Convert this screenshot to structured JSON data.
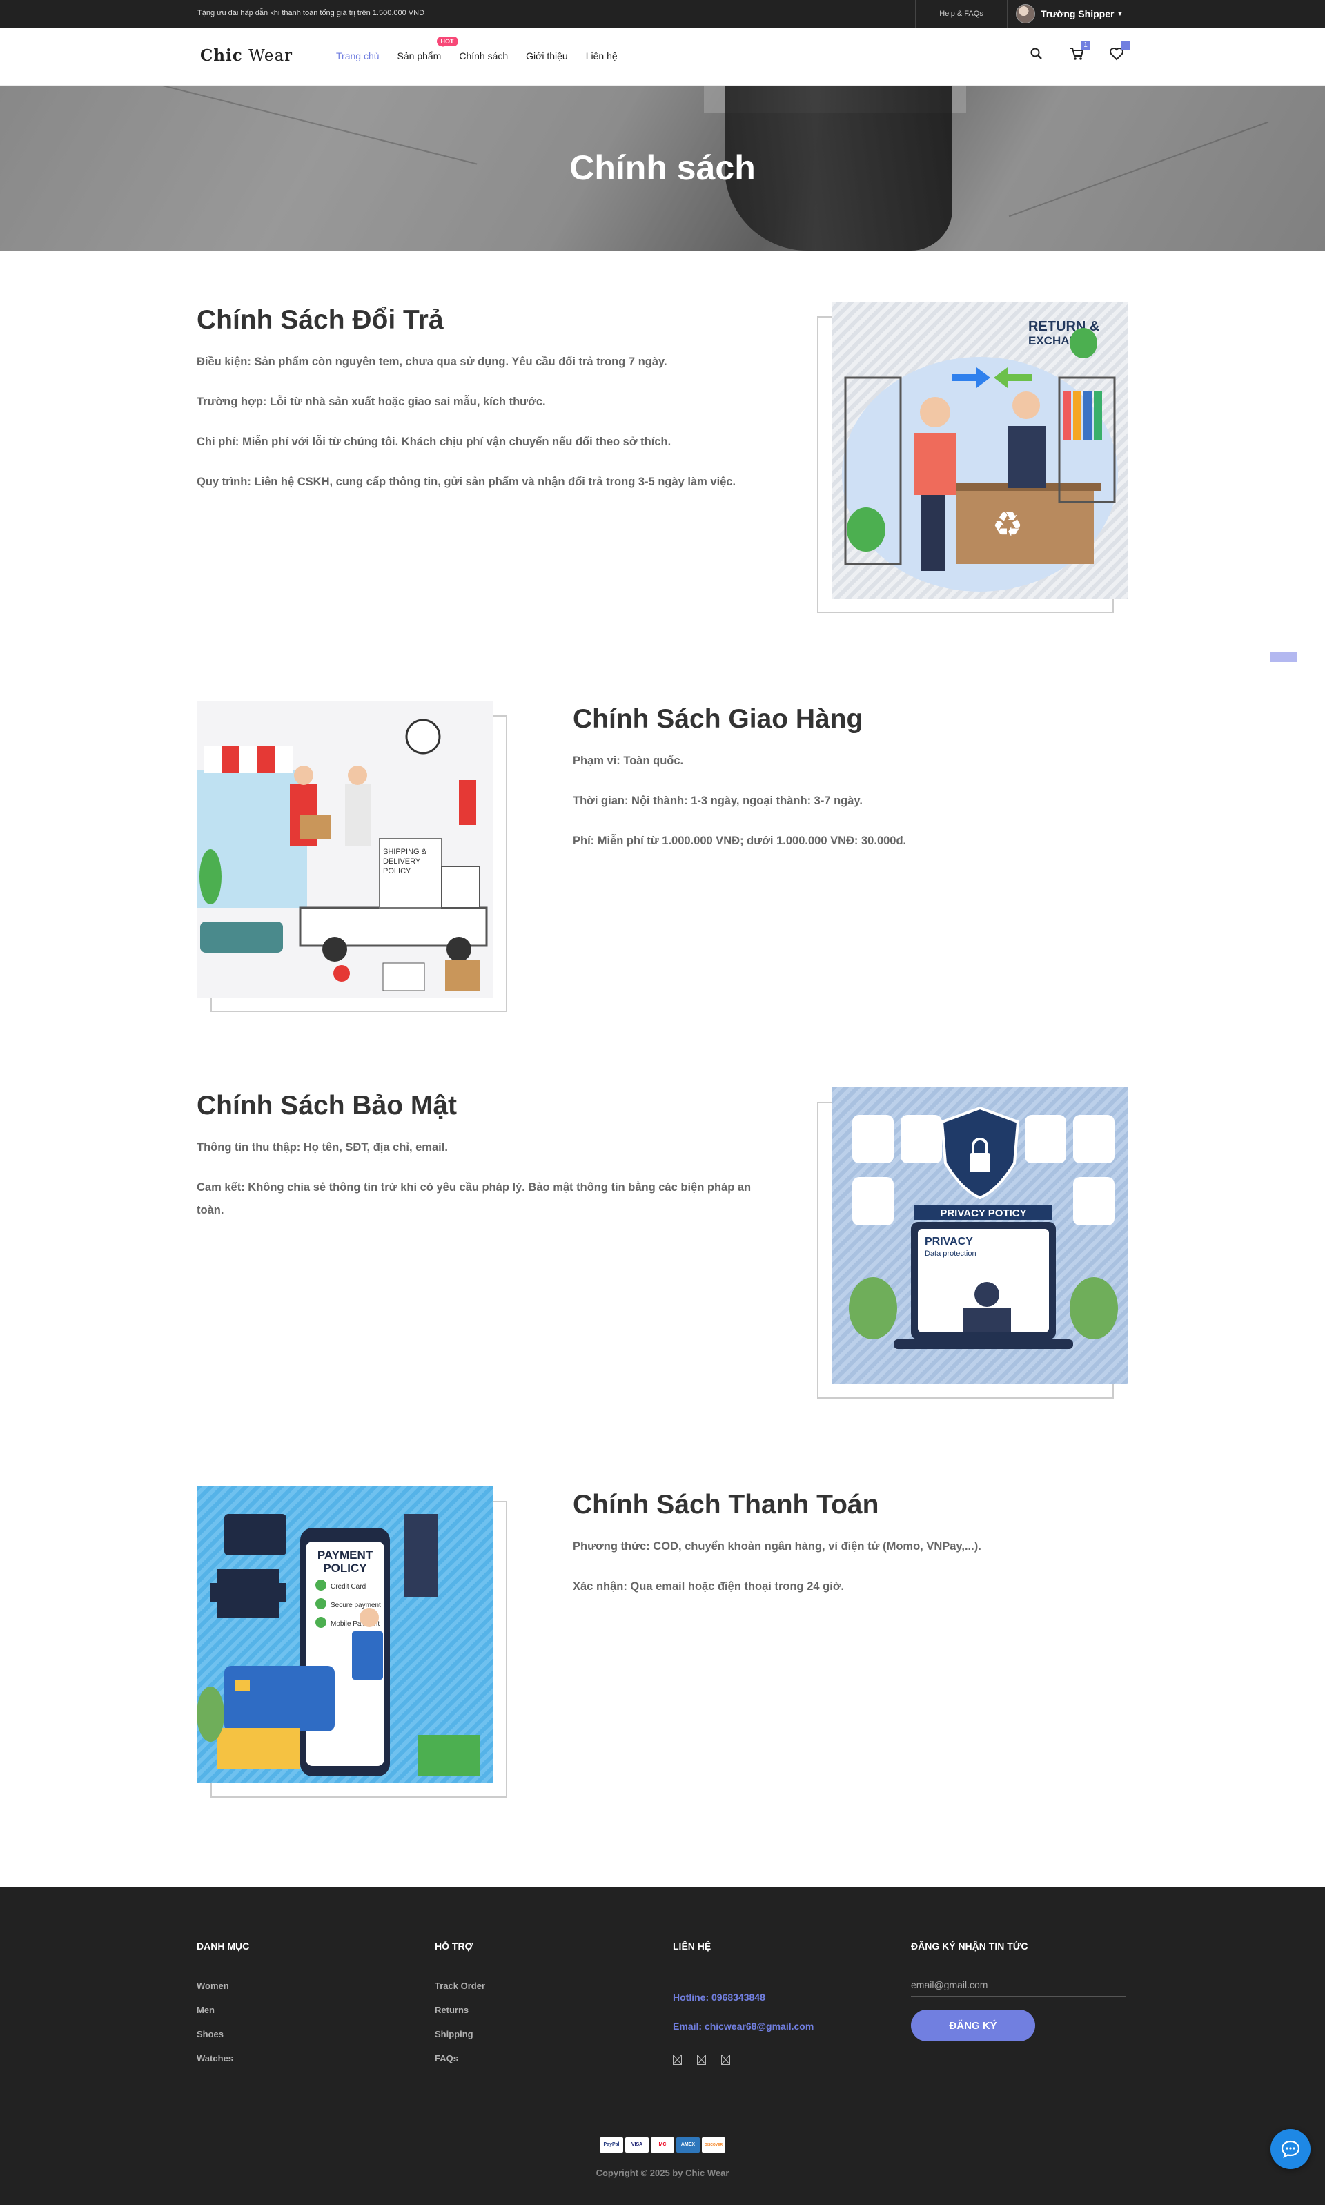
{
  "topbar": {
    "promo": "Tặng ưu đãi hấp dẫn khi thanh toán tổng giá trị trên 1.500.000 VND",
    "help": "Help & FAQs",
    "user_name": "Trường Shipper"
  },
  "header": {
    "logo_bold": "Chic",
    "logo_rest": "Wear",
    "nav": [
      {
        "label": "Trang chủ",
        "active": true
      },
      {
        "label": "Sản phẩm",
        "badge": "HOT"
      },
      {
        "label": "Chính sách"
      },
      {
        "label": "Giới thiệu"
      },
      {
        "label": "Liên hệ"
      }
    ],
    "cart_count": "1",
    "wishlist_count": ""
  },
  "banner": {
    "title": "Chính sách"
  },
  "policies": [
    {
      "title": "Chính Sách Đổi Trả",
      "paragraphs": [
        "Điều kiện: Sản phẩm còn nguyên tem, chưa qua sử dụng. Yêu cầu đổi trả trong 7 ngày.",
        "Trường hợp: Lỗi từ nhà sản xuất hoặc giao sai mẫu, kích thước.",
        "Chi phí: Miễn phí với lỗi từ chúng tôi. Khách chịu phí vận chuyển nếu đổi theo sở thích.",
        "Quy trình: Liên hệ CSKH, cung cấp thông tin, gửi sản phẩm và nhận đổi trả trong 3-5 ngày làm việc."
      ],
      "image_text": [
        "RETURN &",
        "EXCHANGE"
      ]
    },
    {
      "title": "Chính Sách Giao Hàng",
      "paragraphs": [
        "Phạm vi: Toàn quốc.",
        "Thời gian: Nội thành: 1-3 ngày, ngoại thành: 3-7 ngày.",
        "Phí: Miễn phí từ 1.000.000 VNĐ; dưới 1.000.000 VNĐ: 30.000đ."
      ],
      "image_text": [
        "SHIPPING &",
        "DELIVERY",
        "POLICY"
      ]
    },
    {
      "title": "Chính Sách Bảo Mật",
      "paragraphs": [
        "Thông tin thu thập: Họ tên, SĐT, địa chỉ, email.",
        "Cam kết: Không chia sẻ thông tin trừ khi có yêu cầu pháp lý. Bảo mật thông tin bằng các biện pháp an toàn."
      ],
      "image_text": [
        "PRIVACY POTICY",
        "PRIVACY",
        "Data protection"
      ]
    },
    {
      "title": "Chính Sách Thanh Toán",
      "paragraphs": [
        "Phương thức: COD, chuyển khoản ngân hàng, ví điện tử (Momo, VNPay,...).",
        "Xác nhận: Qua email hoặc điện thoại trong 24 giờ."
      ],
      "image_text": [
        "PAYMENT",
        "POLICY",
        "Credit Card",
        "Secure payment",
        "Mobile Pallment"
      ]
    }
  ],
  "footer": {
    "categories_title": "DANH MỤC",
    "categories": [
      "Women",
      "Men",
      "Shoes",
      "Watches"
    ],
    "support_title": "HỖ TRỢ",
    "support": [
      "Track Order",
      "Returns",
      "Shipping",
      "FAQs"
    ],
    "contact_title": "LIÊN HỆ",
    "hotline": "Hotline: 0968343848",
    "email": "Email: chicwear68@gmail.com",
    "newsletter_title": "ĐĂNG KÝ NHẬN TIN TỨC",
    "email_placeholder": "email@gmail.com",
    "subscribe_label": "ĐĂNG KÝ",
    "payments": [
      "PayPal",
      "VISA",
      "MC",
      "AMEX",
      "DISCOVER"
    ],
    "copyright": "Copyright © 2025 by Chic Wear"
  },
  "colors": {
    "accent": "#717fe0",
    "dark": "#222222",
    "hot": "#f74877",
    "chat": "#1e88e5"
  }
}
